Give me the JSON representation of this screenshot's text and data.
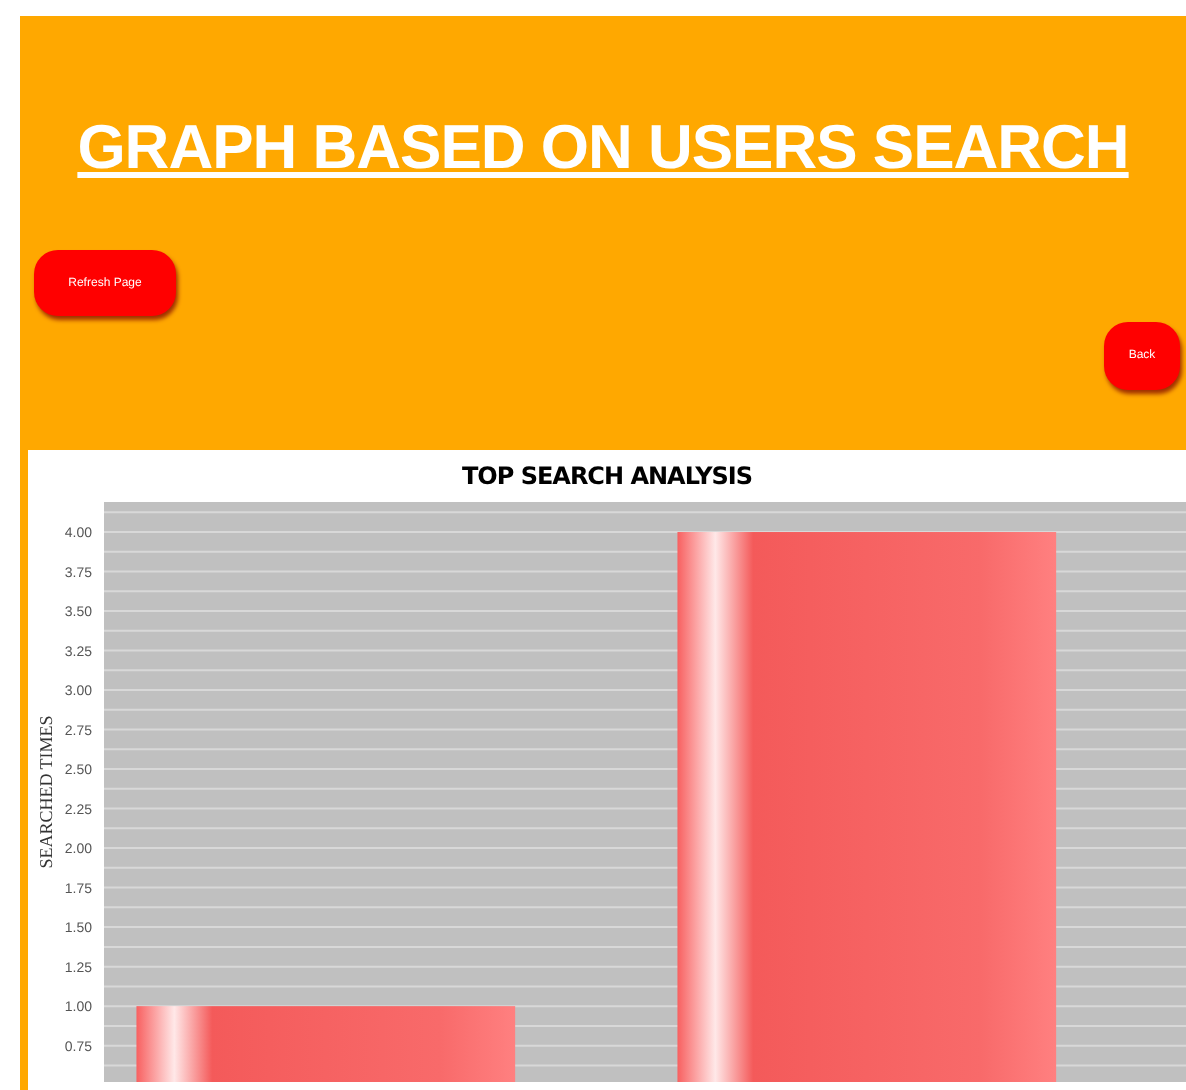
{
  "header": {
    "title": "GRAPH BASED ON USERS SEARCH"
  },
  "buttons": [
    {
      "label": "Refresh Page"
    },
    {
      "label": "Back"
    }
  ],
  "chart": {
    "chart_data": {
      "type": "bar",
      "grid": true,
      "title": "TOP SEARCH ANALYSIS",
      "ylabel": "SEARCHED TIMES",
      "values": [
        1,
        4
      ],
      "ylim": [
        0.52,
        4.19
      ],
      "yticks": [
        {
          "value": 0.75,
          "label": "0.75"
        },
        {
          "value": 1,
          "label": "1.00"
        },
        {
          "value": 1.25,
          "label": "1.25"
        },
        {
          "value": 1.5,
          "label": "1.50"
        },
        {
          "value": 1.75,
          "label": "1.75"
        },
        {
          "value": 2,
          "label": "2.00"
        },
        {
          "value": 2.25,
          "label": "2.25"
        },
        {
          "value": 2.5,
          "label": "2.50"
        },
        {
          "value": 2.75,
          "label": "2.75"
        },
        {
          "value": 3,
          "label": "3.00"
        },
        {
          "value": 3.25,
          "label": "3.25"
        },
        {
          "value": 3.5,
          "label": "3.50"
        },
        {
          "value": 3.75,
          "label": "3.75"
        },
        {
          "value": 4,
          "label": "4.00"
        }
      ]
    }
  }
}
